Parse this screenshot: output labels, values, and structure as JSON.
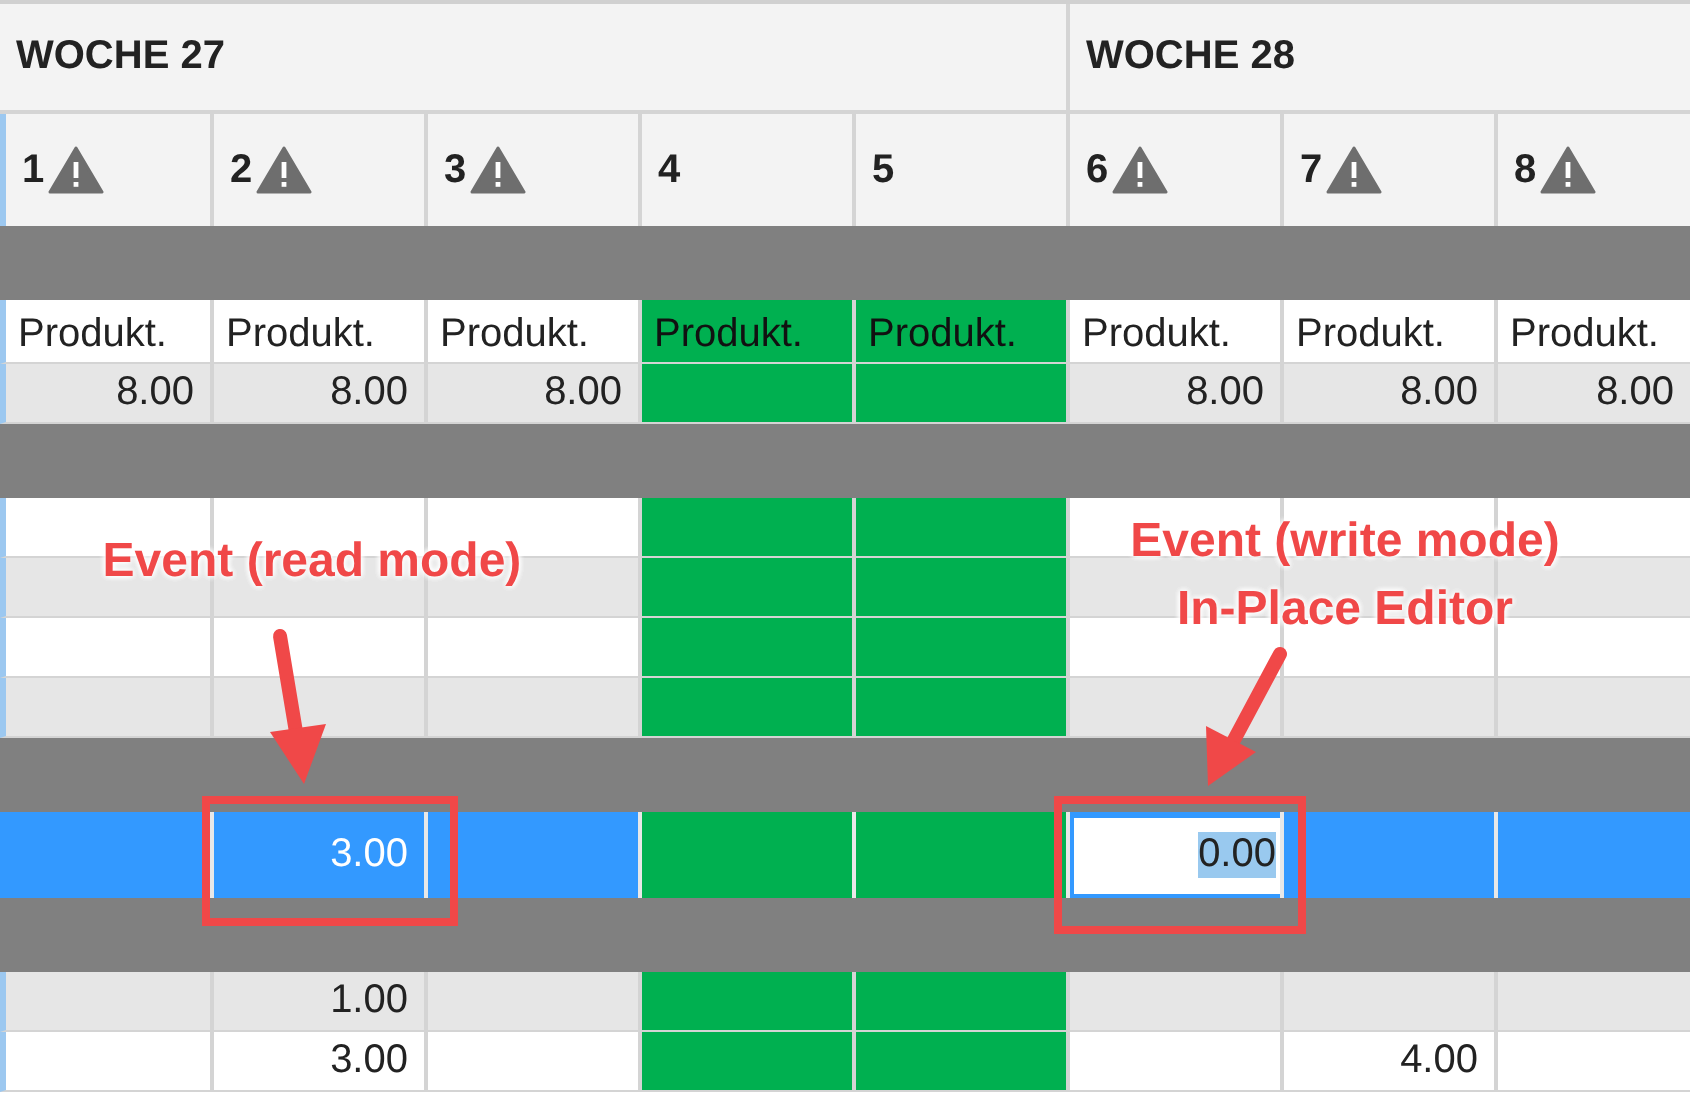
{
  "weeks": [
    {
      "label": "WOCHE 27",
      "days": [
        {
          "label": "1",
          "warning": true,
          "holiday": false
        },
        {
          "label": "2",
          "warning": true,
          "holiday": false
        },
        {
          "label": "3",
          "warning": true,
          "holiday": false
        },
        {
          "label": "4",
          "warning": false,
          "holiday": true
        },
        {
          "label": "5",
          "warning": false,
          "holiday": true
        }
      ]
    },
    {
      "label": "WOCHE 28",
      "days": [
        {
          "label": "6",
          "warning": true,
          "holiday": false
        },
        {
          "label": "7",
          "warning": true,
          "holiday": false
        },
        {
          "label": "8",
          "warning": true,
          "holiday": false
        }
      ]
    }
  ],
  "rows": [
    {
      "kind": "band"
    },
    {
      "kind": "label",
      "shaded": false,
      "selected": false,
      "cells": [
        "Produkt.",
        "Produkt.",
        "Produkt.",
        "Produkt.",
        "Produkt.",
        "Produkt.",
        "Produkt.",
        "Produkt."
      ]
    },
    {
      "kind": "value",
      "shaded": true,
      "selected": false,
      "cells": [
        "8.00",
        "8.00",
        "8.00",
        "",
        "",
        "8.00",
        "8.00",
        "8.00"
      ]
    },
    {
      "kind": "band"
    },
    {
      "kind": "value",
      "shaded": false,
      "selected": false,
      "cells": [
        "",
        "",
        "",
        "",
        "",
        "",
        "",
        ""
      ]
    },
    {
      "kind": "value",
      "shaded": true,
      "selected": false,
      "cells": [
        "",
        "",
        "",
        "",
        "",
        "",
        "",
        ""
      ]
    },
    {
      "kind": "value",
      "shaded": false,
      "selected": false,
      "cells": [
        "",
        "",
        "",
        "",
        "",
        "",
        "",
        ""
      ]
    },
    {
      "kind": "value",
      "shaded": true,
      "selected": false,
      "cells": [
        "",
        "",
        "",
        "",
        "",
        "",
        "",
        ""
      ]
    },
    {
      "kind": "band"
    },
    {
      "kind": "value",
      "shaded": false,
      "selected": true,
      "cells": [
        "",
        "3.00",
        "",
        "",
        "",
        {
          "value": "0.00",
          "editing": true
        },
        "",
        ""
      ]
    },
    {
      "kind": "band"
    },
    {
      "kind": "value",
      "shaded": true,
      "selected": false,
      "cells": [
        "",
        "1.00",
        "",
        "",
        "",
        "",
        "",
        ""
      ]
    },
    {
      "kind": "value",
      "shaded": false,
      "selected": false,
      "cells": [
        "",
        "3.00",
        "",
        "",
        "",
        "",
        "4.00",
        ""
      ]
    }
  ],
  "annotations": [
    {
      "lines": [
        "Event (read mode)"
      ]
    },
    {
      "lines": [
        "Event (write mode)",
        "In-Place Editor"
      ]
    }
  ]
}
